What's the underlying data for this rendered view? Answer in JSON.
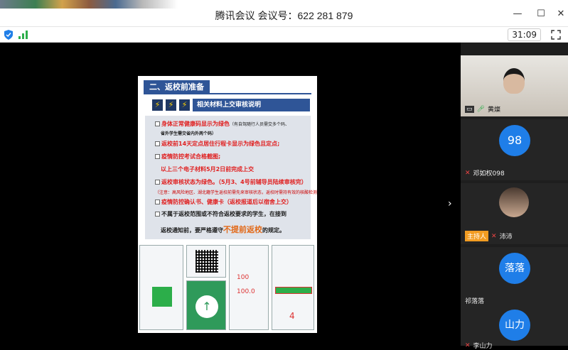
{
  "window": {
    "title": "腾讯会议 会议号：622 281 879"
  },
  "toolbar": {
    "timer": "31:09"
  },
  "slide": {
    "section_title": "二、返校前准备",
    "banner": "相关材料上交审核说明",
    "lines": [
      {
        "text": "身体正常健康码显示为绿色",
        "note": "（有自驾随行人员需交多个码、"
      },
      {
        "text": "省外学生需交省内外两个码）"
      },
      {
        "text": "返校前14天定点居住行程卡显示为绿色且定点;"
      },
      {
        "text": "疫情防控考试合格截图;"
      },
      {
        "text": "以上三个电子材料5月2日前完成上交"
      },
      {
        "text": "返校审核状态为绿色。（5月3、4号前辅导员陆续审核完）"
      },
      {
        "text": "（注意：高风险地区、湖北籍学生返校前需先来审核状态，返校时需持有效的核酸检测报告到校门口接人）"
      },
      {
        "text": "疫情防控确认书、健康卡（返校报道后以宿舍上交）"
      },
      {
        "text": "不属于返校范围或不符合返校要求的学生，在接到"
      },
      {
        "text": "返校通知前，要严格遵守",
        "big": "不提前返校",
        "tail": "的规定。"
      }
    ],
    "phone_values": [
      "100",
      "100.0",
      "4"
    ]
  },
  "participants": [
    {
      "name": "黄燦",
      "type": "video"
    },
    {
      "name": "邓如权098",
      "avatar": "98"
    },
    {
      "name": "沛沛",
      "role": "主持人",
      "type": "photo"
    },
    {
      "name": "祁落落",
      "avatar": "落落"
    },
    {
      "name": "李山力",
      "avatar": "山力"
    }
  ],
  "colors": {
    "accent": "#1f7ee8",
    "slide_blue": "#2f5597",
    "host_badge": "#f29c22",
    "red_text": "#e02020"
  }
}
